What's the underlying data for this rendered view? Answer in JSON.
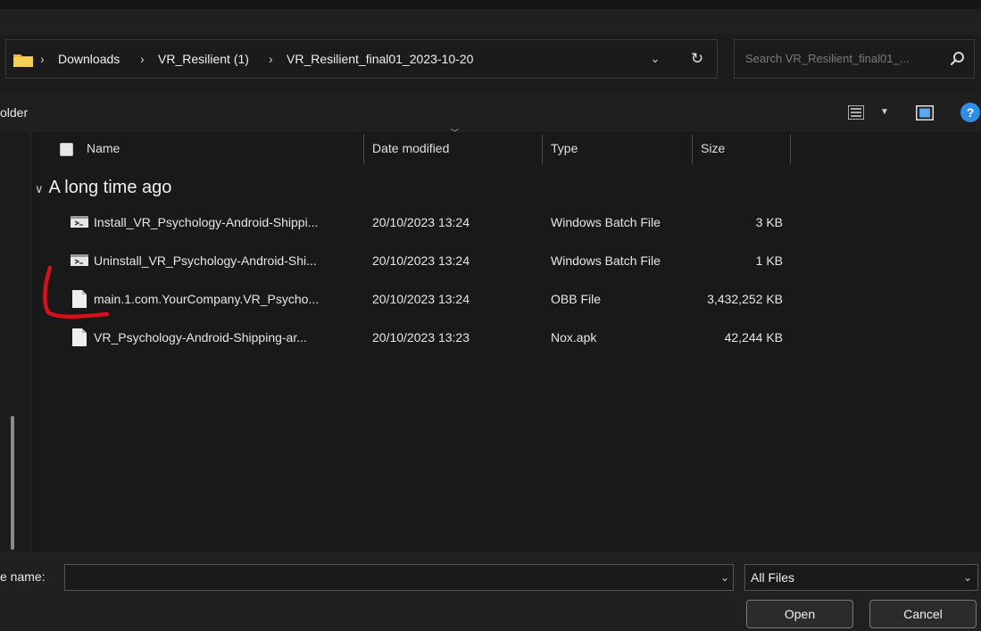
{
  "address": {
    "breadcrumbs": [
      "Downloads",
      "VR_Resilient (1)",
      "VR_Resilient_final01_2023-10-20"
    ],
    "separator": "›",
    "dropdown_glyph": "⌄",
    "refresh_glyph": "↻"
  },
  "search": {
    "placeholder": "Search VR_Resilient_final01_..."
  },
  "command_bar": {
    "new_folder": "older",
    "view_dropdown_glyph": "▼",
    "help_glyph": "?"
  },
  "columns": [
    "Name",
    "Date modified",
    "Type",
    "Size"
  ],
  "group": {
    "label": "A long time ago",
    "chevron": "∨"
  },
  "files": [
    {
      "name": "Install_VR_Psychology-Android-Shippi...",
      "date": "20/10/2023 13:24",
      "type": "Windows Batch File",
      "size": "3 KB",
      "icon": "batch-file-icon"
    },
    {
      "name": "Uninstall_VR_Psychology-Android-Shi...",
      "date": "20/10/2023 13:24",
      "type": "Windows Batch File",
      "size": "1 KB",
      "icon": "batch-file-icon"
    },
    {
      "name": "main.1.com.YourCompany.VR_Psycho...",
      "date": "20/10/2023 13:24",
      "type": "OBB File",
      "size": "3,432,252 KB",
      "icon": "blank-file-icon"
    },
    {
      "name": "VR_Psychology-Android-Shipping-ar...",
      "date": "20/10/2023 13:23",
      "type": "Nox.apk",
      "size": "42,244 KB",
      "icon": "blank-file-icon"
    }
  ],
  "bottom": {
    "file_name_label": "e name:",
    "file_name_value": "",
    "filter": "All Files",
    "dropdown_glyph": "⌄",
    "open_button": "Open",
    "cancel_button": "Cancel"
  },
  "colors": {
    "annotation": "#d3101c",
    "accent": "#2f8de4",
    "folder": "#f2c94c"
  }
}
